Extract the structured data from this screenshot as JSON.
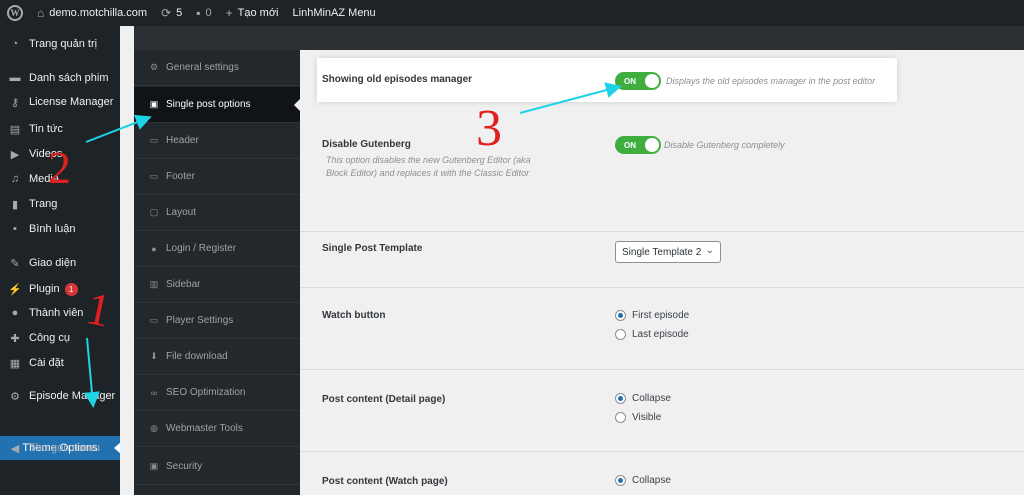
{
  "adminbar": {
    "site": "demo.motchilla.com",
    "updates": "5",
    "comments": "0",
    "new": "Tạo mới",
    "menu": "LinhMinAZ Menu"
  },
  "adminmenu": {
    "items": [
      {
        "label": "Trang quản trị",
        "icon": "dashboard-icon"
      },
      {
        "label": "Danh sách phim",
        "icon": "film-icon"
      },
      {
        "label": "License Manager",
        "icon": "key-icon"
      },
      {
        "label": "Tin tức",
        "icon": "news-icon"
      },
      {
        "label": "Videos",
        "icon": "video-icon"
      },
      {
        "label": "Media",
        "icon": "media-icon"
      },
      {
        "label": "Trang",
        "icon": "page-icon"
      },
      {
        "label": "Bình luận",
        "icon": "comment-icon"
      },
      {
        "label": "Giao diện",
        "icon": "appearance-icon"
      },
      {
        "label": "Plugin",
        "icon": "plugin-icon",
        "badge": "1"
      },
      {
        "label": "Thành viên",
        "icon": "users-icon"
      },
      {
        "label": "Công cụ",
        "icon": "tools-icon"
      },
      {
        "label": "Cài đặt",
        "icon": "settings-icon"
      },
      {
        "label": "Episode Manager",
        "icon": "gear-icon"
      }
    ],
    "active_sub": "Theme Options",
    "collapse": "Thu gọn menu"
  },
  "options_sidebar": [
    {
      "label": "General settings",
      "icon": "gear-icon"
    },
    {
      "label": "Single post options",
      "icon": "card-icon"
    },
    {
      "label": "Header",
      "icon": "header-icon"
    },
    {
      "label": "Footer",
      "icon": "footer-icon"
    },
    {
      "label": "Layout",
      "icon": "layout-icon"
    },
    {
      "label": "Login / Register",
      "icon": "user-icon"
    },
    {
      "label": "Sidebar",
      "icon": "sidebar-icon"
    },
    {
      "label": "Player Settings",
      "icon": "player-icon"
    },
    {
      "label": "File download",
      "icon": "download-icon"
    },
    {
      "label": "SEO Optimization",
      "icon": "link-icon"
    },
    {
      "label": "Webmaster Tools",
      "icon": "globe-icon"
    },
    {
      "label": "Security",
      "icon": "lock-icon"
    }
  ],
  "settings": {
    "old_episodes": {
      "title": "Showing old episodes manager",
      "toggle": "ON",
      "note": "Displays the old episodes manager in the post editor"
    },
    "gutenberg": {
      "title": "Disable Gutenberg",
      "desc": "This option disables the new Gutenberg Editor (aka Block Editor) and replaces it with the Classic Editor",
      "toggle": "ON",
      "note": "Disable Gutenberg completely"
    },
    "template": {
      "title": "Single Post Template",
      "value": "Single Template 2"
    },
    "watch_button": {
      "title": "Watch button",
      "options": [
        "First episode",
        "Last episode"
      ],
      "selected": "First episode"
    },
    "post_content_detail": {
      "title": "Post content (Detail page)",
      "options": [
        "Collapse",
        "Visible"
      ],
      "selected": "Collapse"
    },
    "post_content_watch": {
      "title": "Post content (Watch page)",
      "options": [
        "Collapse"
      ],
      "selected": "Collapse"
    }
  },
  "annotations": {
    "numbers": [
      "1",
      "2",
      "3"
    ]
  },
  "colors": {
    "admin_bg": "#1d2327",
    "accent": "#2271b1",
    "toggle_on": "#3fae3f",
    "arrow": "#1fd3e6",
    "annotation": "#e02020"
  }
}
